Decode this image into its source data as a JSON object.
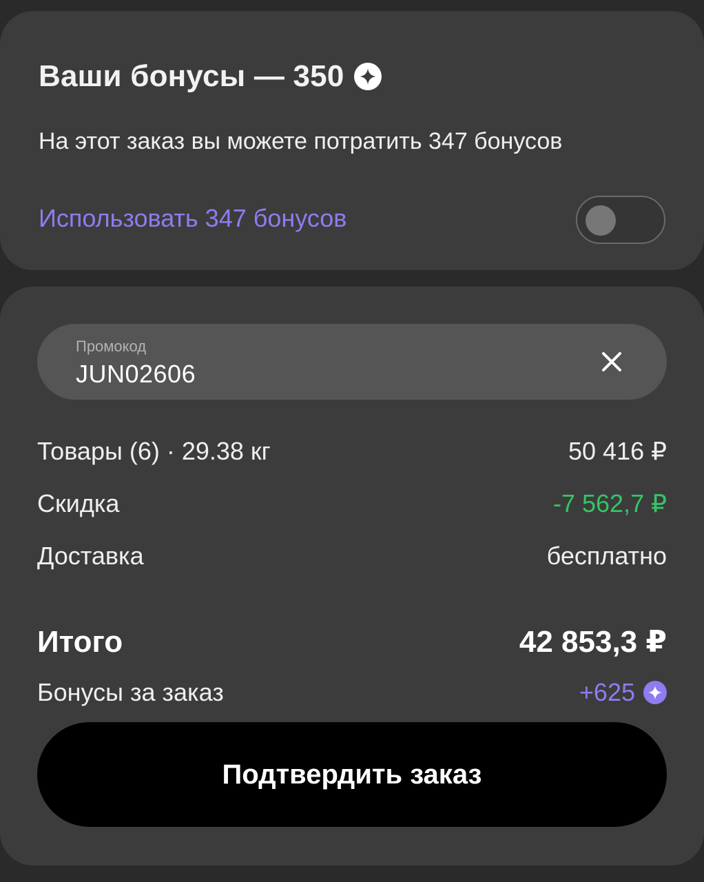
{
  "bonus": {
    "title": "Ваши бонусы — 350",
    "subtitle": "На этот заказ вы можете потратить 347 бонусов",
    "use_label": "Использовать 347 бонусов",
    "toggle_on": false,
    "icon": "sparkle-icon"
  },
  "promo": {
    "label": "Промокод",
    "value": "JUN02606",
    "clear_icon": "close-icon"
  },
  "summary": {
    "items_label": "Товары (6) · 29.38 кг",
    "items_value": "50 416 ₽",
    "discount_label": "Скидка",
    "discount_value": "-7 562,7 ₽",
    "delivery_label": "Доставка",
    "delivery_value": "бесплатно",
    "total_label": "Итого",
    "total_value": "42 853,3 ₽",
    "earn_label": "Бонусы за заказ",
    "earn_value": "+625"
  },
  "actions": {
    "confirm_label": "Подтвердить заказ"
  },
  "colors": {
    "accent": "#8e7cf0",
    "discount": "#34c564",
    "card": "#3c3c3c",
    "background": "#2a2a2a"
  }
}
